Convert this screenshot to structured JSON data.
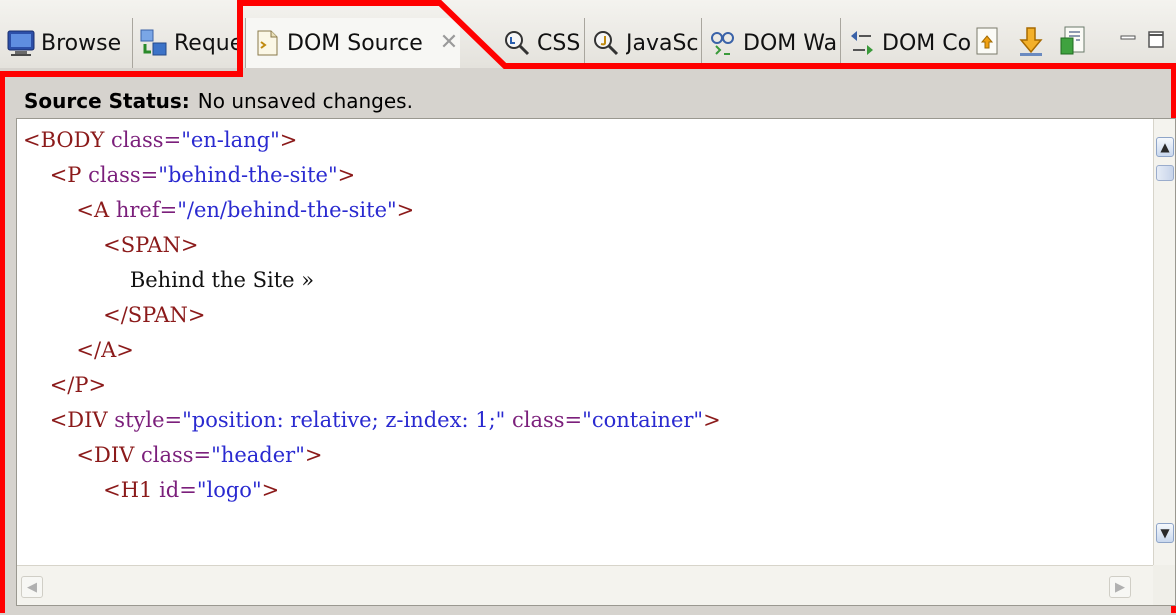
{
  "tabs": [
    {
      "label": "Browse",
      "icon": "monitor-icon"
    },
    {
      "label": "Reque",
      "icon": "request-icon"
    },
    {
      "label": "DOM Source",
      "icon": "page-icon",
      "active": true
    },
    {
      "label": "CSS",
      "icon": "css-search-icon"
    },
    {
      "label": "JavaSc",
      "icon": "javascript-search-icon"
    },
    {
      "label": "DOM Wa",
      "icon": "dom-watch-icon"
    },
    {
      "label": "DOM Co",
      "icon": "dom-compare-icon"
    }
  ],
  "close_glyph": "✕",
  "toolbar_icons": [
    "view-menu-icon",
    "download-arrow-icon",
    "export-icon"
  ],
  "window_controls": [
    "minimize-icon",
    "maximize-icon"
  ],
  "status": {
    "label": "Source Status:",
    "text": "No unsaved changes."
  },
  "source_lines": [
    {
      "indent": 0,
      "tokens": [
        {
          "t": "tag",
          "v": "<BODY"
        },
        {
          "t": "txt",
          "v": " "
        },
        {
          "t": "attr",
          "v": "class="
        },
        {
          "t": "val",
          "v": "\"en-lang\""
        },
        {
          "t": "tag",
          "v": ">"
        }
      ]
    },
    {
      "indent": 1,
      "tokens": [
        {
          "t": "tag",
          "v": "<P"
        },
        {
          "t": "txt",
          "v": " "
        },
        {
          "t": "attr",
          "v": "class="
        },
        {
          "t": "val",
          "v": "\"behind-the-site\""
        },
        {
          "t": "tag",
          "v": ">"
        }
      ]
    },
    {
      "indent": 2,
      "tokens": [
        {
          "t": "tag",
          "v": "<A"
        },
        {
          "t": "txt",
          "v": " "
        },
        {
          "t": "attr",
          "v": "href="
        },
        {
          "t": "val",
          "v": "\"/en/behind-the-site\""
        },
        {
          "t": "tag",
          "v": ">"
        }
      ]
    },
    {
      "indent": 3,
      "tokens": [
        {
          "t": "tag",
          "v": "<SPAN>"
        }
      ]
    },
    {
      "indent": 4,
      "tokens": [
        {
          "t": "txt",
          "v": "Behind the Site »"
        }
      ]
    },
    {
      "indent": 3,
      "tokens": [
        {
          "t": "tag",
          "v": "</SPAN>"
        }
      ]
    },
    {
      "indent": 2,
      "tokens": [
        {
          "t": "tag",
          "v": "</A>"
        }
      ]
    },
    {
      "indent": 1,
      "tokens": [
        {
          "t": "tag",
          "v": "</P>"
        }
      ]
    },
    {
      "indent": 1,
      "tokens": [
        {
          "t": "tag",
          "v": "<DIV"
        },
        {
          "t": "txt",
          "v": " "
        },
        {
          "t": "attr",
          "v": "style="
        },
        {
          "t": "val",
          "v": "\"position: relative; z-index: 1;\""
        },
        {
          "t": "txt",
          "v": " "
        },
        {
          "t": "attr",
          "v": "class="
        },
        {
          "t": "val",
          "v": "\"container\""
        },
        {
          "t": "tag",
          "v": ">"
        }
      ]
    },
    {
      "indent": 2,
      "tokens": [
        {
          "t": "tag",
          "v": "<DIV"
        },
        {
          "t": "txt",
          "v": " "
        },
        {
          "t": "attr",
          "v": "class="
        },
        {
          "t": "val",
          "v": "\"header\""
        },
        {
          "t": "tag",
          "v": ">"
        }
      ]
    },
    {
      "indent": 3,
      "tokens": [
        {
          "t": "tag",
          "v": "<H1"
        },
        {
          "t": "txt",
          "v": " "
        },
        {
          "t": "attr",
          "v": "id="
        },
        {
          "t": "val",
          "v": "\"logo\""
        },
        {
          "t": "tag",
          "v": ">"
        }
      ]
    }
  ],
  "scroll": {
    "up": "▲",
    "down": "▼",
    "left": "◀",
    "right": "▶"
  },
  "colors": {
    "highlight": "#ff0000",
    "tag": "#8b1a1a",
    "attribute": "#7b1f7b",
    "value": "#2a2ad0",
    "text": "#111111"
  }
}
